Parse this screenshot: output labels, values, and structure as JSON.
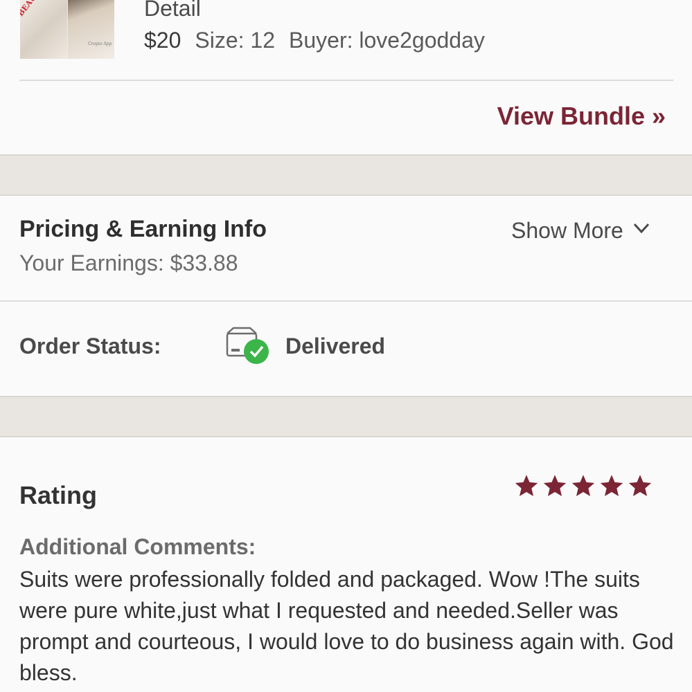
{
  "item": {
    "title_tail": "Detail",
    "price": "$20",
    "size": "Size: 12",
    "buyer": "Buyer: love2godday",
    "thumbnail": {
      "stamp_text": "BEAUTIFUL TWO PIECE",
      "brand_text": "Cropio App"
    }
  },
  "bundle": {
    "view_label": "View Bundle »"
  },
  "pricing": {
    "title": "Pricing & Earning Info",
    "earnings": "Your Earnings: $33.88",
    "show_more": "Show More",
    "chevron_icon": "chevron-down-icon"
  },
  "order": {
    "label": "Order Status:",
    "status": "Delivered",
    "status_icon": "package-delivered-icon",
    "check_color": "#3bb54a"
  },
  "rating": {
    "label": "Rating",
    "stars": 5,
    "max_stars": 5,
    "star_color": "#7b2535",
    "comments_label": "Additional Comments:",
    "comment": "Suits were professionally folded and packaged. Wow !The suits were pure white,just what I requested and needed.Seller was prompt and courteous, I would love to do business again with. God bless."
  },
  "colors": {
    "accent": "#7b2535",
    "band": "#e9e6e1"
  }
}
